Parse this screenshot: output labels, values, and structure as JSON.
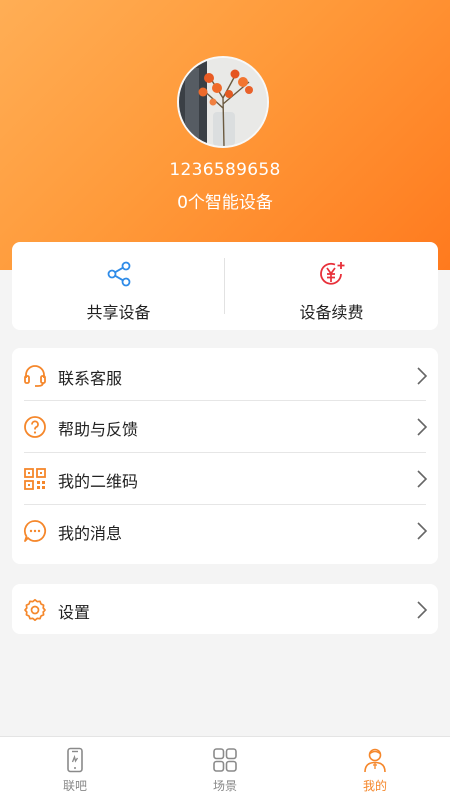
{
  "colors": {
    "accent": "#f5872b",
    "header_start": "#ffae55",
    "header_end": "#ff7a1e",
    "background": "#f4f4f4"
  },
  "profile": {
    "phone": "1236589658",
    "device_count_text": "0个智能设备"
  },
  "quick_actions": [
    {
      "label": "共享设备",
      "icon": "share-icon"
    },
    {
      "label": "设备续费",
      "icon": "renew-yuan-icon"
    }
  ],
  "menu": [
    {
      "label": "联系客服",
      "icon": "headset-icon"
    },
    {
      "label": "帮助与反馈",
      "icon": "help-icon"
    },
    {
      "label": "我的二维码",
      "icon": "qr-code-icon"
    },
    {
      "label": "我的消息",
      "icon": "message-icon"
    }
  ],
  "settings": {
    "label": "设置",
    "icon": "gear-icon"
  },
  "tabbar": {
    "active": "我的",
    "tabs": [
      {
        "label": "联吧",
        "icon": "phone-device-icon"
      },
      {
        "label": "场景",
        "icon": "grid-icon"
      },
      {
        "label": "我的",
        "icon": "person-icon"
      }
    ]
  }
}
